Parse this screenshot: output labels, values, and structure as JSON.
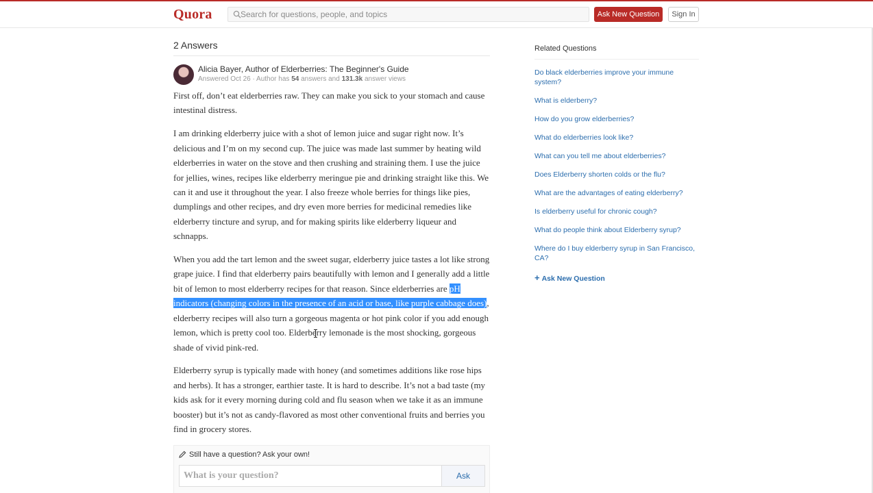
{
  "header": {
    "logo": "Quora",
    "search_placeholder": "Search for questions, people, and topics",
    "ask_button": "Ask New Question",
    "signin_button": "Sign In"
  },
  "answer_section": {
    "count_label": "2 Answers",
    "author": {
      "name": "Alicia Bayer, Author of Elderberries: The Beginner's Guide",
      "answered": "Answered Oct 26 · Author has ",
      "answers_count": "54",
      "answers_mid": " answers and ",
      "views_count": "131.3k",
      "views_suffix": " answer views"
    },
    "paragraphs": [
      "First off, don’t eat elderberries raw. They can make you sick to your stomach and cause intestinal distress.",
      "I am drinking elderberry juice with a shot of lemon juice and sugar right now. It’s delicious and I’m on my second cup. The juice was made last summer by heating wild elderberries in water on the stove and then crushing and straining them. I use the juice for jellies, wines, recipes like elderberry meringue pie and drinking straight like this. We can it and use it throughout the year. I also freeze whole berries for things like pies, dumplings and other recipes, and dry even more berries for medicinal remedies like elderberry tincture and syrup, and for making spirits like elderberry liqueur and schnapps."
    ],
    "para3_before": "When you add the tart lemon and the sweet sugar, elderberry juice tastes a lot like strong grape juice. I find that elderberry pairs beautifully with lemon and I generally add a little bit of lemon to most elderberry recipes for that reason. Since elderberries are ",
    "para3_highlight": "pH indicators (changing colors in the presence of an acid or base, like purple cabbage does)",
    "para3_after": ", elderberry recipes will also turn a gorgeous magenta or hot pink color if you add enough lemon, which is pretty cool too. Elderberry lemonade is the most shocking, gorgeous shade of vivid pink-red.",
    "para4": "Elderberry syrup is typically made with honey (and sometimes additions like rose hips and herbs). It has a stronger, earthier taste. It is hard to describe. It’s not a bad taste (my kids ask for it every morning during cold and flu season when we take it as an immune booster) but it’s not as candy-flavored as most other conventional fruits and berries you find in grocery stores."
  },
  "ask_box": {
    "prompt": "Still have a question? Ask your own!",
    "placeholder": "What is your question?",
    "button": "Ask"
  },
  "sidebar": {
    "heading": "Related Questions",
    "questions": [
      "Do black elderberries improve your immune system?",
      "What is elderberry?",
      "How do you grow elderberries?",
      "What do elderberries look like?",
      "What can you tell me about elderberries?",
      "Does Elderberry shorten colds or the flu?",
      "What are the advantages of eating elderberry?",
      "Is elderberry useful for chronic cough?",
      "What do people think about Elderberry syrup?",
      "Where do I buy elderberry syrup in San Francisco, CA?"
    ],
    "ask_link": "Ask New Question"
  },
  "colors": {
    "brand": "#b92b27",
    "link": "#2b6dad",
    "selection": "#3390ff"
  },
  "icons": [
    "search-icon",
    "pencil-icon",
    "plus-icon"
  ]
}
